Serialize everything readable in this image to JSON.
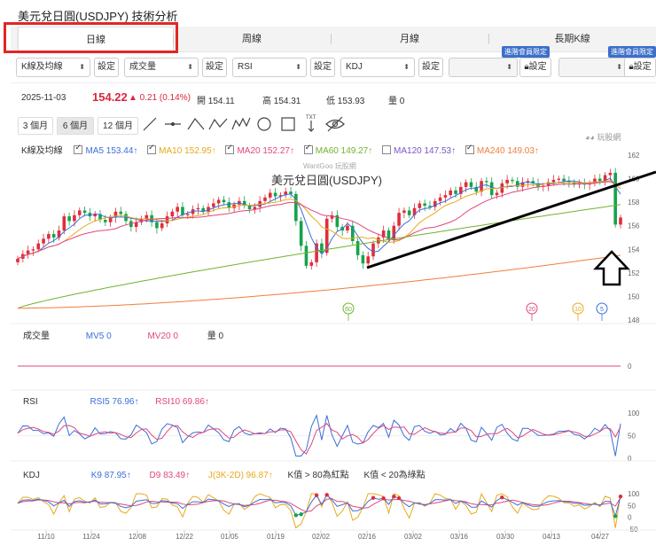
{
  "page": {
    "title": "美元兌日圓(USDJPY) 技術分析"
  },
  "tabs": [
    {
      "label": "日線",
      "active": true
    },
    {
      "label": "周線"
    },
    {
      "label": "月線"
    },
    {
      "label": "長期K線"
    }
  ],
  "controls": {
    "selects": [
      "K線及均線",
      "成交量",
      "RSI",
      "KDJ",
      "",
      ""
    ],
    "set_label": "設定",
    "vip_badge": "進階會員限定"
  },
  "quote": {
    "date": "2025-11-03",
    "price": "154.22",
    "change": "▲ 0.21 (0.14%)",
    "open_label": "開",
    "open": "154.11",
    "high_label": "高",
    "high": "154.31",
    "low_label": "低",
    "low": "153.93",
    "vol_label": "量",
    "vol": "0"
  },
  "toolbar": {
    "ranges": [
      "3 個月",
      "6 個月",
      "12 個月"
    ],
    "active_range": "6 個月"
  },
  "ma_legend": {
    "label": "K線及均線",
    "items": [
      {
        "name": "MA5",
        "value": "153.44↑",
        "color": "#3a6fd8",
        "checked": true
      },
      {
        "name": "MA10",
        "value": "152.95↑",
        "color": "#e8a91c",
        "checked": true
      },
      {
        "name": "MA20",
        "value": "152.27↑",
        "color": "#e0477a",
        "checked": true
      },
      {
        "name": "MA60",
        "value": "149.27↑",
        "color": "#6fb42c",
        "checked": true
      },
      {
        "name": "MA120",
        "value": "147.53↑",
        "color": "#7b55c7",
        "checked": false
      },
      {
        "name": "MA240",
        "value": "149.03↑",
        "color": "#f07d3c",
        "checked": true
      }
    ]
  },
  "watermark": "WantGoo 玩股網",
  "logo_text": "玩股網",
  "volume_legend": {
    "label": "成交量",
    "mv5": "MV5 0",
    "mv20": "MV20 0",
    "vol": "量 0"
  },
  "rsi_legend": {
    "label": "RSI",
    "rsi5": "RSI5 76.96↑",
    "rsi10": "RSI10 69.86↑"
  },
  "kdj_legend": {
    "label": "KDJ",
    "k": "K9 87.95↑",
    "d": "D9 83.49↑",
    "j": "J(3K-2D) 96.87↑",
    "note1": "K值 > 80為紅點",
    "note2": "K值 < 20為綠點"
  },
  "colors": {
    "up": "#e02d3a",
    "down": "#16a34a",
    "accent": "#d9263c"
  },
  "chart_data": [
    {
      "type": "candlestick",
      "title": "美元兌日圓(USDJPY)",
      "ylim": [
        148,
        162
      ],
      "yticks": [
        148,
        150,
        152,
        154,
        156,
        158,
        160,
        162
      ],
      "xticks": [
        "11/10",
        "11/24",
        "12/08",
        "12/22",
        "01/05",
        "01/19",
        "02/02",
        "02/16",
        "03/02",
        "03/16",
        "03/30",
        "04/13",
        "04/27"
      ],
      "close": [
        153.2,
        153.6,
        153.9,
        154.0,
        154.5,
        154.9,
        155.3,
        155.0,
        155.6,
        156.8,
        156.4,
        156.9,
        157.3,
        157.1,
        156.8,
        157.0,
        156.5,
        156.3,
        156.7,
        157.2,
        157.0,
        156.4,
        155.9,
        156.3,
        156.6,
        156.9,
        156.3,
        155.8,
        156.2,
        156.8,
        157.2,
        157.6,
        156.9,
        157.0,
        157.4,
        157.5,
        157.2,
        157.6,
        157.9,
        158.2,
        158.0,
        157.5,
        157.8,
        158.1,
        157.7,
        157.4,
        157.6,
        158.1,
        158.4,
        158.8,
        158.5,
        158.6,
        158.9,
        158.7,
        156.4,
        154.3,
        152.6,
        152.9,
        154.5,
        153.7,
        156.6,
        156.9,
        155.9,
        155.6,
        156.0,
        154.7,
        153.5,
        152.8,
        153.4,
        154.5,
        155.0,
        155.6,
        154.8,
        156.0,
        157.1,
        157.3,
        156.9,
        157.5,
        157.9,
        157.7,
        157.6,
        158.1,
        158.4,
        158.6,
        159.0,
        158.7,
        159.3,
        159.7,
        159.3,
        158.9,
        159.8,
        159.7,
        158.6,
        158.8,
        159.6,
        159.9,
        159.8,
        159.3,
        159.7,
        159.8,
        159.6,
        159.3,
        159.4,
        159.7,
        159.9,
        160.0,
        159.8,
        159.7,
        159.5,
        159.6,
        159.5,
        159.6,
        160.0,
        159.8,
        160.3,
        160.5,
        156.1,
        156.7
      ],
      "ma_lines": [
        "MA5",
        "MA10",
        "MA20",
        "MA60",
        "MA240"
      ],
      "ma240": {
        "start": 149.0,
        "end": 153.5
      },
      "ma60_end": 157.8,
      "annotations": {
        "markers": [
          "60",
          "20",
          "10",
          "5"
        ],
        "trendline": "support",
        "arrow": "up"
      }
    },
    {
      "type": "bar",
      "title": "成交量",
      "ylim": [
        0,
        1
      ],
      "yticks": [
        0
      ],
      "series": [
        {
          "name": "MV5",
          "values": [
            0
          ]
        },
        {
          "name": "MV20",
          "values": [
            0
          ]
        }
      ]
    },
    {
      "type": "line",
      "title": "RSI",
      "ylim": [
        0,
        100
      ],
      "yticks": [
        0,
        50,
        100
      ],
      "series": [
        {
          "name": "RSI5",
          "last": 76.96
        },
        {
          "name": "RSI10",
          "last": 69.86
        }
      ]
    },
    {
      "type": "line",
      "title": "KDJ",
      "ylim": [
        -50,
        100
      ],
      "yticks": [
        -50,
        0,
        50,
        100
      ],
      "series": [
        {
          "name": "K9",
          "last": 87.95
        },
        {
          "name": "D9",
          "last": 83.49
        },
        {
          "name": "J(3K-2D)",
          "last": 96.87
        }
      ]
    }
  ]
}
